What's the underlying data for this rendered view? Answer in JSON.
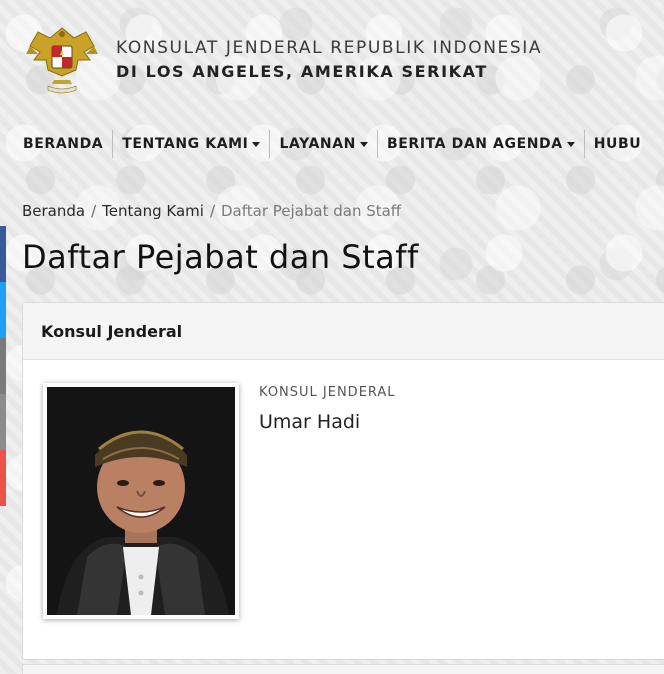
{
  "header": {
    "org_name": "KONSULAT JENDERAL REPUBLIK INDONESIA",
    "org_sub": "DI LOS ANGELES, AMERIKA SERIKAT",
    "emblem_icon": "garuda-pancasila-emblem"
  },
  "nav": {
    "items": [
      {
        "label": "BERANDA",
        "has_dropdown": false
      },
      {
        "label": "TENTANG KAMI",
        "has_dropdown": true
      },
      {
        "label": "LAYANAN",
        "has_dropdown": true
      },
      {
        "label": "BERITA DAN AGENDA",
        "has_dropdown": true
      },
      {
        "label": "HUBU",
        "has_dropdown": false
      }
    ]
  },
  "breadcrumb": {
    "home": "Beranda",
    "parent": "Tentang Kami",
    "separator": "/",
    "current": "Daftar Pejabat dan Staff"
  },
  "page": {
    "title": "Daftar Pejabat dan Staff"
  },
  "panel": {
    "heading": "Konsul Jenderal",
    "staff": [
      {
        "role": "KONSUL JENDERAL",
        "name": "Umar Hadi"
      }
    ]
  },
  "social_strip_colors": [
    "#3b5998",
    "#1da1f2",
    "#7a7a7a",
    "#8c8c8c",
    "#e8544b"
  ],
  "colors": {
    "background": "#ececec",
    "panel_bg": "#ffffff",
    "panel_heading_bg": "#f5f5f5",
    "text_dark": "#1a1a1a",
    "text_muted": "#7a7a7a"
  }
}
